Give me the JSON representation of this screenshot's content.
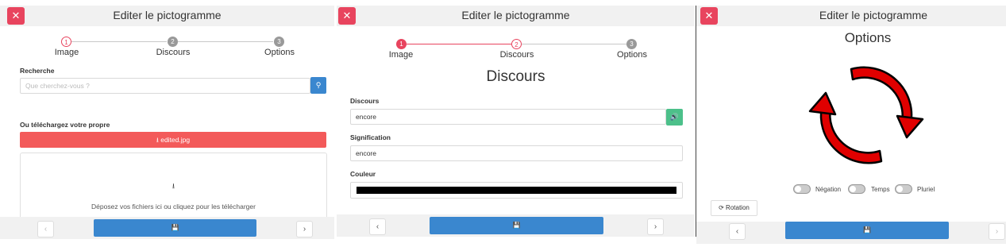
{
  "dialog": {
    "title": "Editer le pictogramme",
    "close_icon": "✕"
  },
  "steps": [
    {
      "number": "1",
      "label": "Image"
    },
    {
      "number": "2",
      "label": "Discours"
    },
    {
      "number": "3",
      "label": "Options"
    }
  ],
  "panel1": {
    "search_label": "Recherche",
    "search_placeholder": "Que cherchez-vous ?",
    "search_icon": "⚲",
    "upload_label": "Ou téléchargez votre propre",
    "upload_button": "⭳ edited.jpg",
    "dropzone_icon": "⭳",
    "dropzone_text": "Déposez vos fichiers ici ou cliquez pour les télécharger"
  },
  "panel2": {
    "heading": "Discours",
    "speech_label": "Discours",
    "speech_value": "encore",
    "meaning_label": "Signification",
    "meaning_value": "encore",
    "color_label": "Couleur",
    "color_value": "#000000",
    "speaker_icon": "🔊"
  },
  "panel3": {
    "heading": "Options",
    "toggles": [
      {
        "label": "Négation"
      },
      {
        "label": "Temps"
      },
      {
        "label": "Pluriel"
      }
    ],
    "rotation_button": "⟳ Rotation"
  },
  "nav": {
    "prev": "‹",
    "next": "›",
    "save_icon": "💾"
  },
  "colors": {
    "accent": "#e8445e",
    "primary": "#3a87cf",
    "success": "#4cc08a"
  }
}
